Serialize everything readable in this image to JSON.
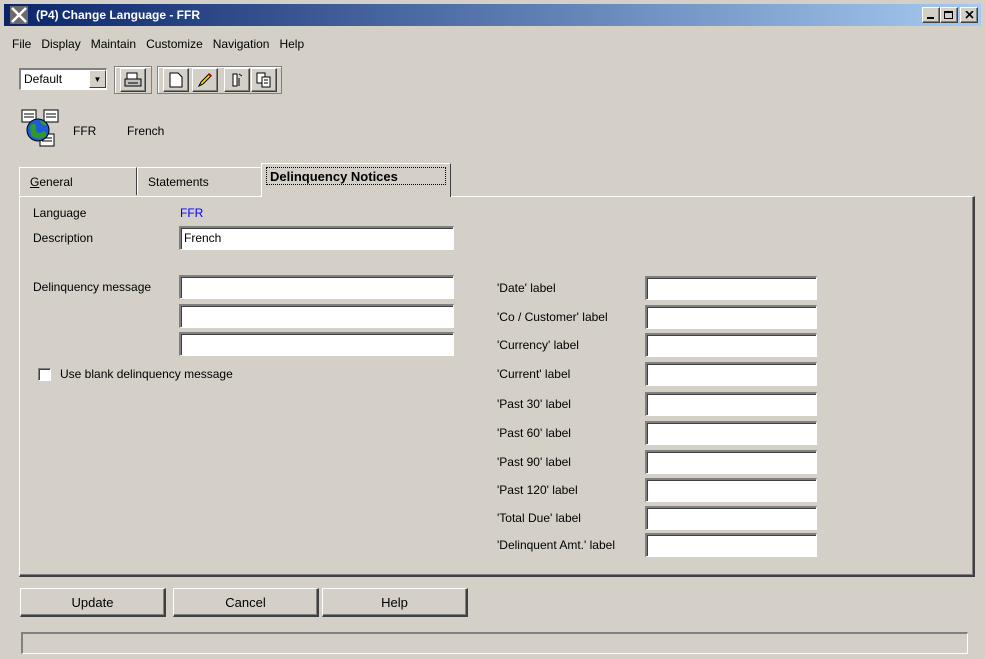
{
  "window": {
    "title": "(P4) Change Language - FFR"
  },
  "menu": [
    "File",
    "Display",
    "Maintain",
    "Customize",
    "Navigation",
    "Help"
  ],
  "toolbar": {
    "view_value": "Default"
  },
  "header": {
    "code": "FFR",
    "name": "French"
  },
  "tabs": [
    {
      "label": "General",
      "active": false
    },
    {
      "label": "Statements",
      "active": false
    },
    {
      "label": "Delinquency Notices",
      "active": true
    }
  ],
  "form": {
    "language_label": "Language",
    "language_value": "FFR",
    "language_color": "#0000ff",
    "description_label": "Description",
    "description_value": "French",
    "delinquency_label": "Delinquency message",
    "delinquency_lines": [
      "",
      "",
      ""
    ],
    "blank_checkbox_label": "Use blank delinquency message",
    "blank_checkbox_checked": false,
    "labels": [
      {
        "label": "'Date' label",
        "value": ""
      },
      {
        "label": "'Co / Customer' label",
        "value": ""
      },
      {
        "label": "'Currency' label",
        "value": ""
      },
      {
        "label": "'Current' label",
        "value": ""
      },
      {
        "label": "'Past 30' label",
        "value": ""
      },
      {
        "label": "'Past 60' label",
        "value": ""
      },
      {
        "label": "'Past 90' label",
        "value": ""
      },
      {
        "label": "'Past 120' label",
        "value": ""
      },
      {
        "label": "'Total Due' label",
        "value": ""
      },
      {
        "label": "'Delinquent Amt.' label",
        "value": ""
      }
    ]
  },
  "buttons": {
    "update": "Update",
    "cancel": "Cancel",
    "help": "Help"
  },
  "status": {
    "text": ""
  }
}
